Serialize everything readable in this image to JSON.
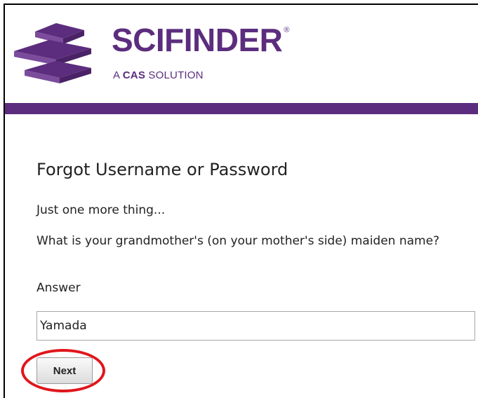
{
  "brand": {
    "name": "SCIFINDER",
    "registered_mark": "®",
    "tagline_prefix": "A",
    "tagline_strong": "CAS",
    "tagline_suffix": "SOLUTION",
    "logo_icon": "scifinder-logo-icon",
    "color": "#5c2d7e"
  },
  "page": {
    "title": "Forgot Username or Password",
    "intro": "Just one more thing...",
    "question": "What is your grandmother's (on your mother's side) maiden name?",
    "answer_label": "Answer",
    "answer_value": "Yamada",
    "next_label": "Next"
  },
  "annotation": {
    "color": "#e0161b",
    "target": "next-button"
  }
}
